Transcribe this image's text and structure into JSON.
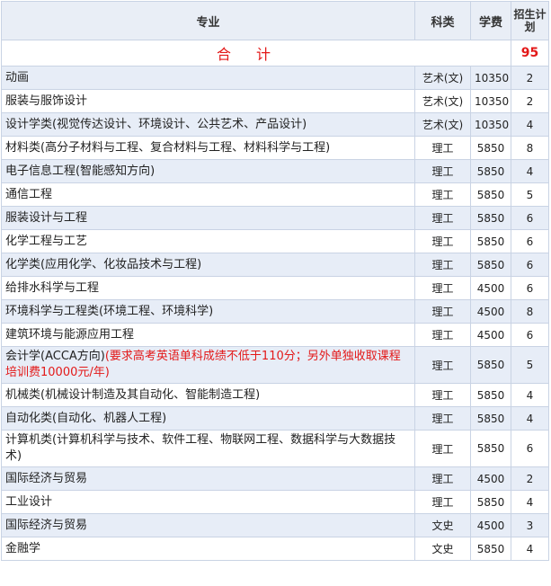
{
  "headers": {
    "major": "专业",
    "category": "科类",
    "fee": "学费",
    "quota": "招生计划"
  },
  "total": {
    "label": "合计",
    "count": "95"
  },
  "rows": [
    {
      "major": "动画",
      "note": "",
      "category": "艺术(文)",
      "fee": "10350",
      "quota": "2"
    },
    {
      "major": "服装与服饰设计",
      "note": "",
      "category": "艺术(文)",
      "fee": "10350",
      "quota": "2"
    },
    {
      "major": "设计学类(视觉传达设计、环境设计、公共艺术、产品设计)",
      "note": "",
      "category": "艺术(文)",
      "fee": "10350",
      "quota": "4"
    },
    {
      "major": "材料类(高分子材料与工程、复合材料与工程、材料科学与工程)",
      "note": "",
      "category": "理工",
      "fee": "5850",
      "quota": "8"
    },
    {
      "major": "电子信息工程(智能感知方向)",
      "note": "",
      "category": "理工",
      "fee": "5850",
      "quota": "4"
    },
    {
      "major": "通信工程",
      "note": "",
      "category": "理工",
      "fee": "5850",
      "quota": "5"
    },
    {
      "major": "服装设计与工程",
      "note": "",
      "category": "理工",
      "fee": "5850",
      "quota": "6"
    },
    {
      "major": "化学工程与工艺",
      "note": "",
      "category": "理工",
      "fee": "5850",
      "quota": "6"
    },
    {
      "major": "化学类(应用化学、化妆品技术与工程)",
      "note": "",
      "category": "理工",
      "fee": "5850",
      "quota": "6"
    },
    {
      "major": "给排水科学与工程",
      "note": "",
      "category": "理工",
      "fee": "4500",
      "quota": "6"
    },
    {
      "major": "环境科学与工程类(环境工程、环境科学)",
      "note": "",
      "category": "理工",
      "fee": "4500",
      "quota": "8"
    },
    {
      "major": "建筑环境与能源应用工程",
      "note": "",
      "category": "理工",
      "fee": "4500",
      "quota": "6"
    },
    {
      "major": "会计学(ACCA方向)",
      "note": "(要求高考英语单科成绩不低于110分；另外单独收取课程培训费10000元/年)",
      "category": "理工",
      "fee": "5850",
      "quota": "5"
    },
    {
      "major": "机械类(机械设计制造及其自动化、智能制造工程)",
      "note": "",
      "category": "理工",
      "fee": "5850",
      "quota": "4"
    },
    {
      "major": "自动化类(自动化、机器人工程)",
      "note": "",
      "category": "理工",
      "fee": "5850",
      "quota": "4"
    },
    {
      "major": "计算机类(计算机科学与技术、软件工程、物联网工程、数据科学与大数据技术)",
      "note": "",
      "category": "理工",
      "fee": "5850",
      "quota": "6"
    },
    {
      "major": "国际经济与贸易",
      "note": "",
      "category": "理工",
      "fee": "4500",
      "quota": "2"
    },
    {
      "major": "工业设计",
      "note": "",
      "category": "理工",
      "fee": "5850",
      "quota": "4"
    },
    {
      "major": "国际经济与贸易",
      "note": "",
      "category": "文史",
      "fee": "4500",
      "quota": "3"
    },
    {
      "major": "金融学",
      "note": "",
      "category": "文史",
      "fee": "5850",
      "quota": "4"
    }
  ]
}
